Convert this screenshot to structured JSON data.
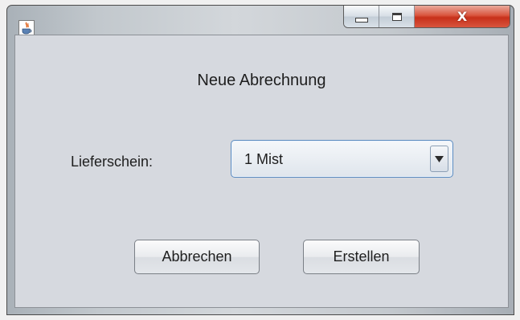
{
  "window": {
    "caption_buttons": {
      "minimize_icon": "minimize-icon",
      "maximize_icon": "maximize-icon",
      "close_icon": "close-icon",
      "close_glyph": "X"
    },
    "app_icon": "java-cup-icon"
  },
  "dialog": {
    "title": "Neue Abrechnung",
    "delivery_note": {
      "label": "Lieferschein:",
      "selected_value": "1 Mist"
    },
    "buttons": {
      "cancel": "Abbrechen",
      "create": "Erstellen"
    }
  },
  "colors": {
    "client_background": "#d6d9df",
    "combo_focus_border": "#5c8bbf",
    "close_button": "#c7301a"
  }
}
